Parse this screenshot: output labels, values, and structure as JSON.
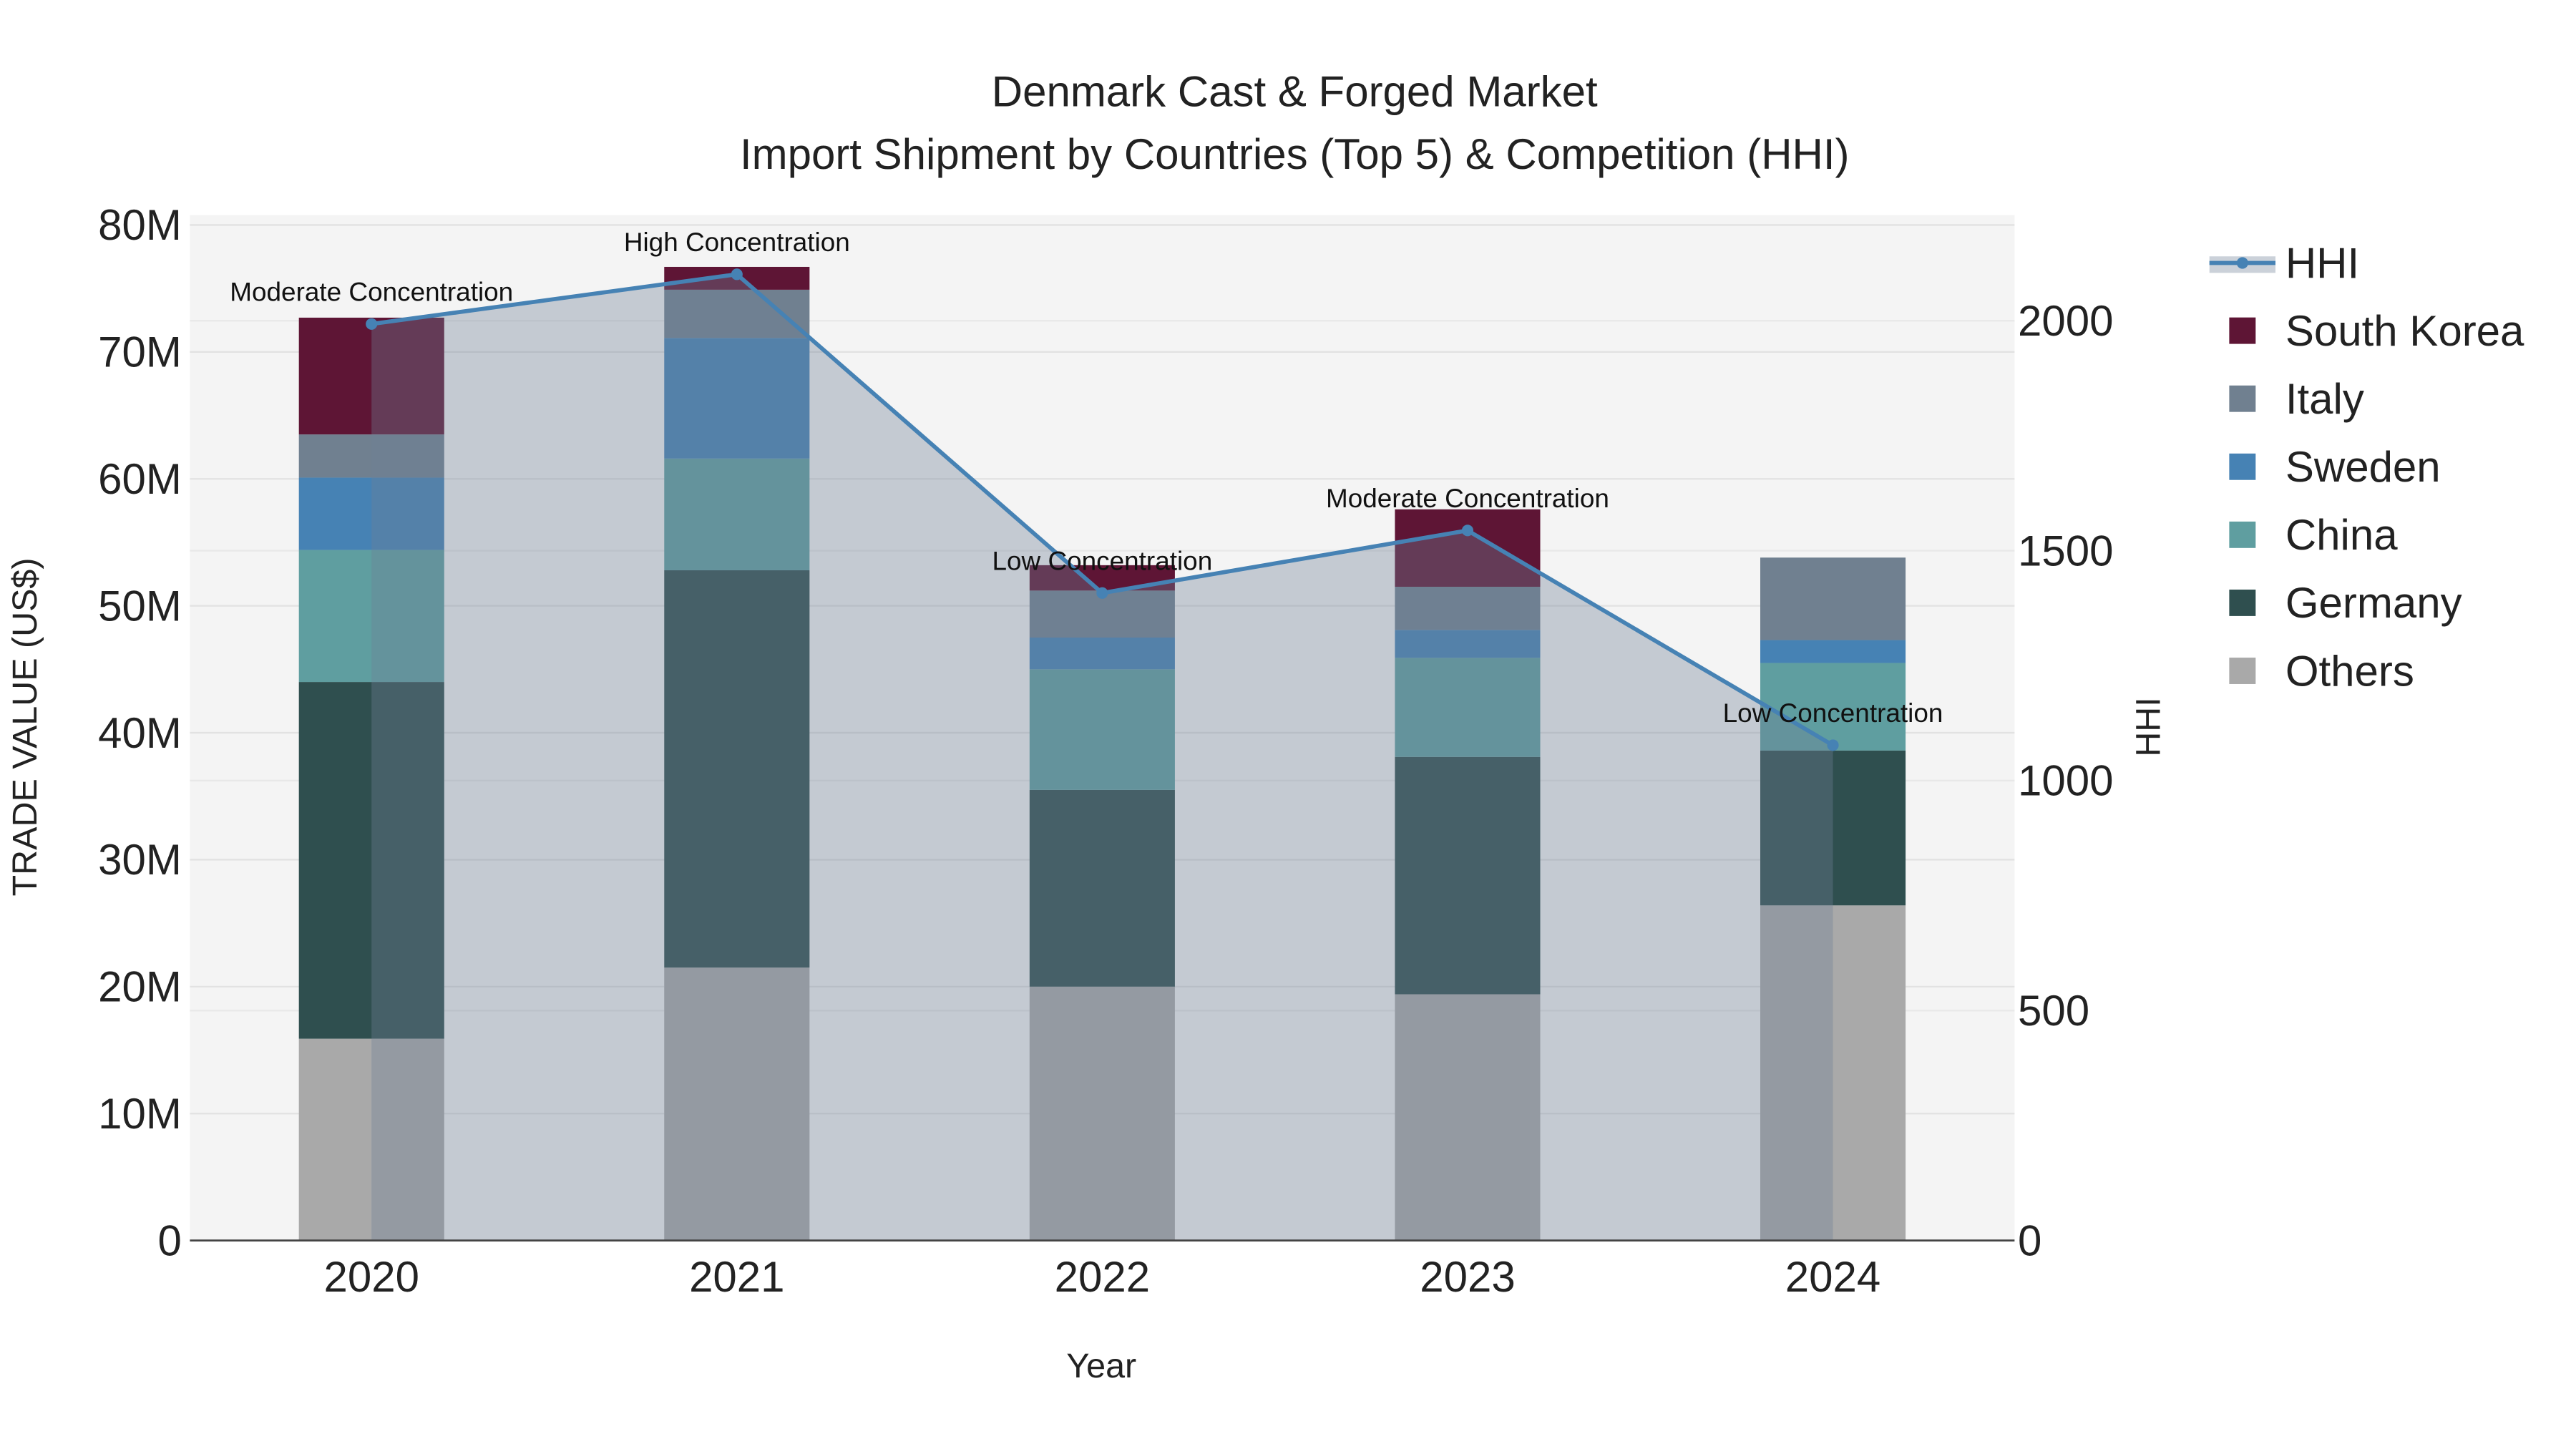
{
  "chart_data": {
    "type": "bar",
    "title": "Denmark Cast & Forged Market",
    "subtitle": "Import Shipment by Countries (Top 5) & Competition (HHI)",
    "xlabel": "Year",
    "ylabel": "TRADE VALUE (US$)",
    "y2label": "HHI",
    "categories": [
      "2020",
      "2021",
      "2022",
      "2023",
      "2024"
    ],
    "ylim": [
      0,
      80000000
    ],
    "y_ticks": [
      0,
      10000000,
      20000000,
      30000000,
      40000000,
      50000000,
      60000000,
      70000000,
      80000000
    ],
    "y_tick_labels": [
      "0",
      "10M",
      "20M",
      "30M",
      "40M",
      "50M",
      "60M",
      "70M",
      "80M"
    ],
    "y2lim": [
      0,
      2222
    ],
    "y2_ticks": [
      0,
      500,
      1000,
      1500,
      2000
    ],
    "y2_tick_labels": [
      "0",
      "500",
      "1000",
      "1500",
      "2000"
    ],
    "legend_position": "right",
    "series": [
      {
        "name": "Others",
        "color": "#a9a9a9",
        "values": [
          15.9,
          21.5,
          20.0,
          19.4,
          26.4
        ]
      },
      {
        "name": "Germany",
        "color": "#2f4f4f",
        "values": [
          28.1,
          31.3,
          15.5,
          18.7,
          12.2
        ]
      },
      {
        "name": "China",
        "color": "#5f9ea0",
        "values": [
          10.4,
          8.8,
          9.5,
          7.8,
          6.9
        ]
      },
      {
        "name": "Sweden",
        "color": "#4682b4",
        "values": [
          5.7,
          9.5,
          2.5,
          2.2,
          1.8
        ]
      },
      {
        "name": "Italy",
        "color": "#708090",
        "values": [
          3.4,
          3.8,
          3.7,
          3.4,
          6.5
        ]
      },
      {
        "name": "South Korea",
        "color": "#5e1535",
        "values": [
          9.2,
          1.8,
          2.0,
          6.1,
          0
        ]
      }
    ],
    "values_unit": "million US$",
    "hhi": {
      "name": "HHI",
      "color": "#4682b4",
      "values": [
        1993,
        2101,
        1408,
        1544,
        1077
      ],
      "labels": [
        "Moderate Concentration",
        "High Concentration",
        "Low Concentration",
        "Moderate Concentration",
        "Low Concentration"
      ]
    }
  }
}
